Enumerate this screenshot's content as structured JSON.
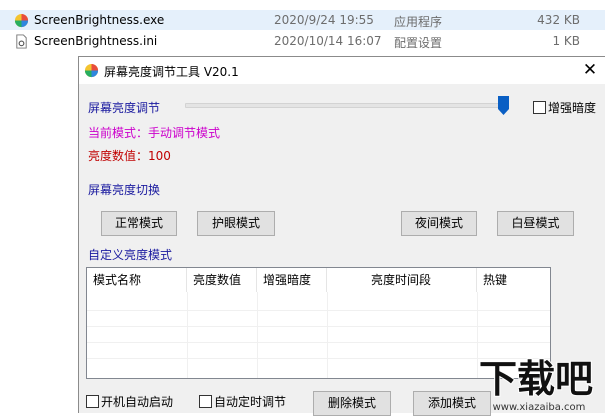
{
  "explorer": {
    "files": [
      {
        "name": "ScreenBrightness.exe",
        "date": "2020/9/24 19:55",
        "type": "应用程序",
        "size": "432 KB"
      },
      {
        "name": "ScreenBrightness.ini",
        "date": "2020/10/14 16:07",
        "type": "配置设置",
        "size": "1 KB"
      }
    ]
  },
  "window": {
    "title": "屏幕亮度调节工具 V20.1",
    "close": "✕"
  },
  "brightness": {
    "label": "屏幕亮度调节",
    "enhance_label": "增强暗度",
    "slider_value_percent": 100,
    "mode_text": "当前模式：手动调节模式",
    "value_text": "亮度数值：100"
  },
  "switch": {
    "label": "屏幕亮度切换",
    "buttons": [
      "正常模式",
      "护眼模式",
      "夜间模式",
      "白昼模式"
    ]
  },
  "custom": {
    "label": "自定义亮度模式",
    "columns": [
      "模式名称",
      "亮度数值",
      "增强暗度",
      "亮度时间段",
      "热键"
    ]
  },
  "bottom": {
    "autostart": "开机自动启动",
    "autotimer": "自动定时调节",
    "delete_btn": "删除模式",
    "add_btn": "添加模式"
  },
  "watermark": {
    "text": "下载吧",
    "url": "www.xiazaiba.com"
  },
  "colors": {
    "accent_blue": "#1a1a9f",
    "mode_magenta": "#cc00cc",
    "value_red": "#c00000",
    "thumb_blue": "#0a5fc4"
  }
}
